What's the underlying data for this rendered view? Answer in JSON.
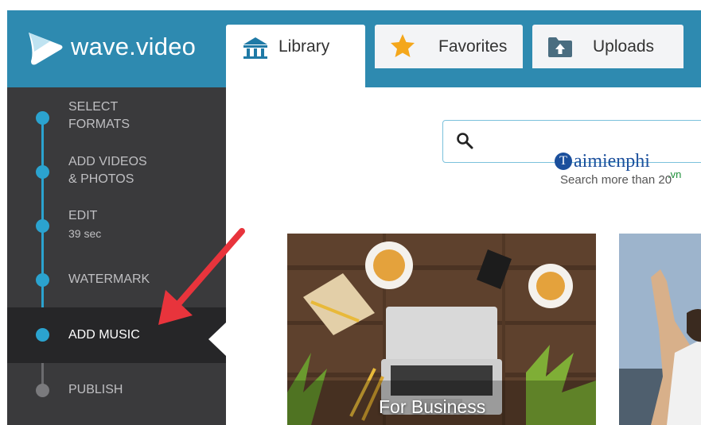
{
  "brand": {
    "name": "wave.video"
  },
  "tabs": [
    {
      "label": "Library",
      "icon": "library-icon",
      "active": true
    },
    {
      "label": "Favorites",
      "icon": "star-icon",
      "active": false
    },
    {
      "label": "Uploads",
      "icon": "upload-folder-icon",
      "active": false
    }
  ],
  "steps": [
    {
      "label_line1": "SELECT",
      "label_line2": "FORMATS"
    },
    {
      "label_line1": "ADD VIDEOS",
      "label_line2": "& PHOTOS"
    },
    {
      "label": "EDIT",
      "sub": "39 sec"
    },
    {
      "label": "WATERMARK"
    },
    {
      "label": "ADD MUSIC",
      "active": true
    },
    {
      "label": "PUBLISH"
    }
  ],
  "search": {
    "placeholder": "",
    "hint": "Search more than 20"
  },
  "watermark": {
    "text": "aimienphi",
    "logo_letter": "T",
    "suffix": ".vn"
  },
  "cards": [
    {
      "caption": "For Business"
    }
  ],
  "colors": {
    "brand_blue": "#2e8ab0",
    "step_accent": "#2ba3cf",
    "sidebar_bg": "#3a3a3c",
    "arrow_red": "#e8343c"
  }
}
